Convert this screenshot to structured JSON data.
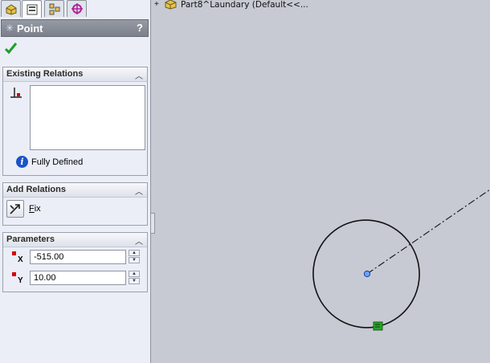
{
  "tabs": [
    {
      "name": "feature-manager-tab"
    },
    {
      "name": "property-manager-tab",
      "active": true
    },
    {
      "name": "configuration-manager-tab"
    },
    {
      "name": "dimxpert-manager-tab"
    }
  ],
  "property_manager": {
    "title": "Point",
    "help": "?"
  },
  "existing_relations": {
    "header": "Existing Relations",
    "status": "Fully Defined"
  },
  "add_relations": {
    "header": "Add Relations",
    "fix_label_prefix": "F",
    "fix_label_rest": "ix"
  },
  "parameters": {
    "header": "Parameters",
    "x_axis": "X",
    "x_value": "-515.00",
    "y_axis": "Y",
    "y_value": "10.00"
  },
  "tree": {
    "expand": "+",
    "part_label": "Part8^Laundary  (Default<<..."
  },
  "colors": {
    "point": "#6aa2ff",
    "relation_marker": "#26a626"
  }
}
